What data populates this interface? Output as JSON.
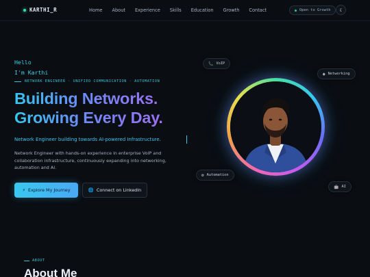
{
  "nav": {
    "logo": "KARTHI_R",
    "links": [
      "Home",
      "About",
      "Experience",
      "Skills",
      "Education",
      "Growth",
      "Contact"
    ],
    "status_badge": "Open to Growth",
    "theme_icon": "moon-icon"
  },
  "hero": {
    "greeting": "Hello",
    "name_line": "I'm Karthi",
    "role_line": "NETWORK ENGINEER · UNIFIED COMMUNICATION · AUTOMATION",
    "headline_1": "Building Networks.",
    "headline_2": "Growing Every Day.",
    "tagline": "Network Engineer building towards AI-powered Infrastructure.",
    "description": "Network Engineer with hands-on experience in enterprise VoIP and collaboration infrastructure, continuously expanding into networking, automation and AI.",
    "primary_button": "Explore My Journey",
    "secondary_button": "Connect on LinkedIn"
  },
  "chips": {
    "voip": "VoIP",
    "networking": "Networking",
    "automation": "Automation",
    "ai": "AI"
  },
  "about": {
    "tag": "ABOUT",
    "title": "About Me"
  },
  "colors": {
    "background": "#0a0d12",
    "accent_cyan": "#38c9f0",
    "accent_purple": "#9d6ff0",
    "status_green": "#22d38b"
  }
}
